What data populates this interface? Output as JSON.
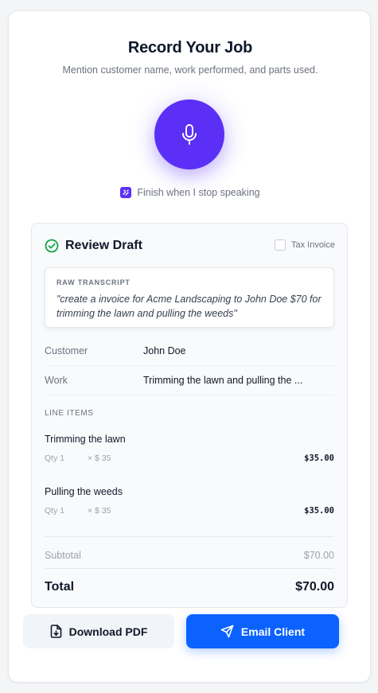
{
  "header": {
    "title": "Record Your Job",
    "subtitle": "Mention customer name, work performed, and parts used."
  },
  "recorder": {
    "mic_icon": "microphone-icon",
    "finish_label": "Finish when I stop speaking",
    "finish_icon": "auto-stop-icon"
  },
  "review": {
    "title": "Review Draft",
    "status_icon": "check-circle-icon",
    "tax_invoice_label": "Tax Invoice",
    "transcript_label": "RAW TRANSCRIPT",
    "transcript_text": "\"create a invoice for Acme Landscaping to John Doe $70 for trimming the lawn and pulling the weeds\"",
    "fields": [
      {
        "label": "Customer",
        "value": "John Doe"
      },
      {
        "label": "Work",
        "value": "Trimming the lawn and pulling the ..."
      }
    ],
    "line_items_label": "LINE ITEMS",
    "line_items": [
      {
        "name": "Trimming the lawn",
        "qty": "Qty 1",
        "rate": "× $ 35",
        "amount": "$35.00"
      },
      {
        "name": "Pulling the weeds",
        "qty": "Qty 1",
        "rate": "× $ 35",
        "amount": "$35.00"
      }
    ],
    "subtotal_label": "Subtotal",
    "subtotal_value": "$70.00",
    "total_label": "Total",
    "total_value": "$70.00"
  },
  "actions": {
    "download_label": "Download PDF",
    "download_icon": "file-download-icon",
    "email_label": "Email Client",
    "email_icon": "send-icon"
  },
  "colors": {
    "accent_purple": "#5b2ff5",
    "accent_blue": "#0b62ff",
    "success_green": "#16a34a"
  }
}
